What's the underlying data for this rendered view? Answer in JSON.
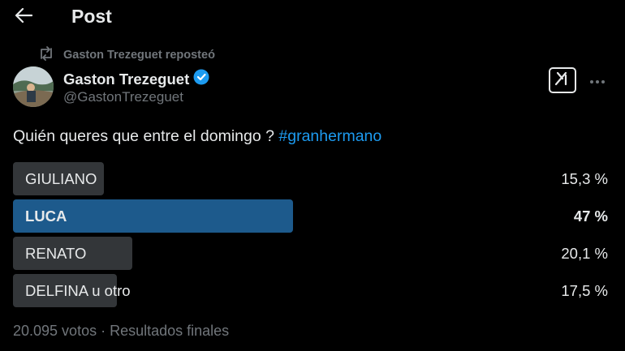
{
  "header": {
    "title": "Post",
    "back_icon": "arrow-left-icon"
  },
  "repost": {
    "icon": "repost-icon",
    "text": "Gaston Trezeguet reposteó"
  },
  "author": {
    "name": "Gaston Trezeguet",
    "handle": "@GastonTrezeguet",
    "verified_icon": "verified-badge-icon",
    "avatar": "avatar"
  },
  "actions": {
    "grok_icon": "grok-icon",
    "more_icon": "more-icon"
  },
  "post": {
    "text": "Quién queres que entre el domingo ? ",
    "hashtag": "#granhermano"
  },
  "poll": {
    "options": [
      {
        "label": "GIULIANO",
        "percent_text": "15,3 %",
        "share": 15.3,
        "winner": false
      },
      {
        "label": "LUCA",
        "percent_text": "47 %",
        "share": 47,
        "winner": true
      },
      {
        "label": "RENATO",
        "percent_text": "20,1 %",
        "share": 20.1,
        "winner": false
      },
      {
        "label": "DELFINA u otro",
        "percent_text": "17,5 %",
        "share": 17.5,
        "winner": false
      }
    ],
    "footer": "20.095 votos · Resultados finales"
  },
  "colors": {
    "background": "#000000",
    "accent": "#1d9bf0",
    "winner_bar": "#1d5a8c",
    "bar": "#333639",
    "muted": "#71767b"
  }
}
